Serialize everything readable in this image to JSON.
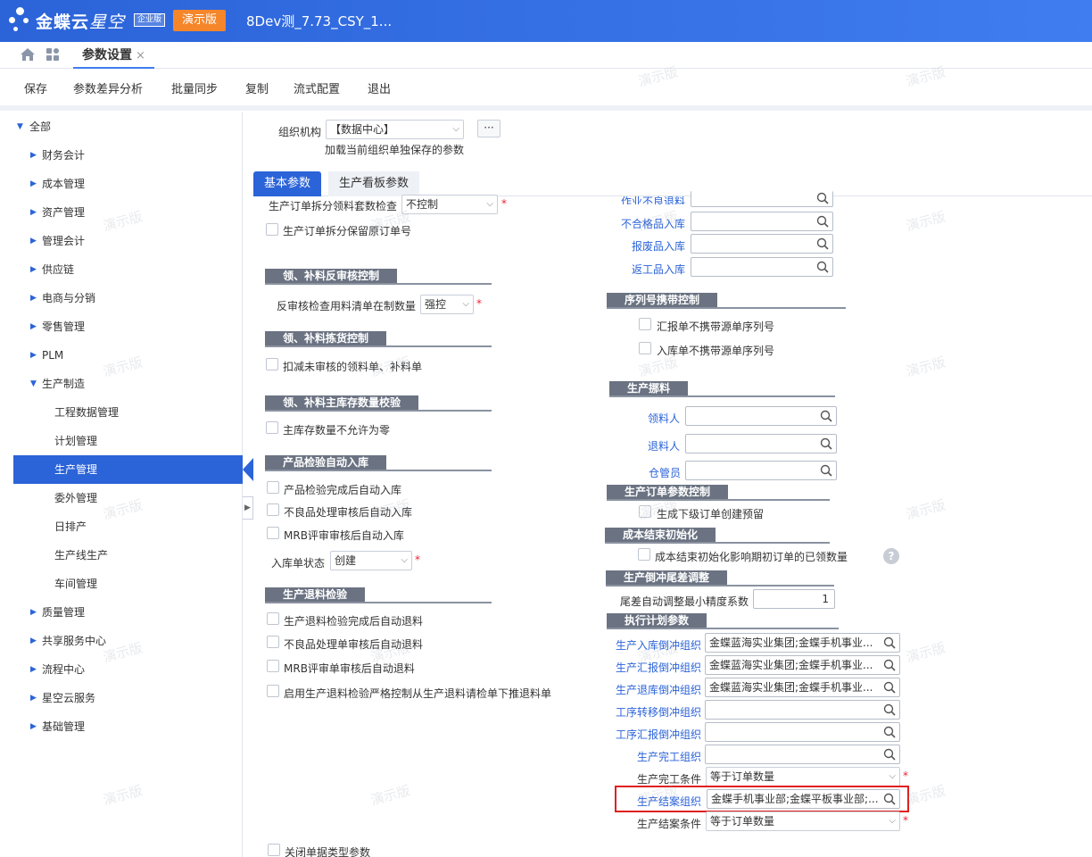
{
  "header": {
    "brand": "金蝶云",
    "brand_sub": "星空",
    "edition_badge": "企业版",
    "demo_button": "演示版",
    "db_title": "8Dev测_7.73_CSY_1..."
  },
  "tabs": {
    "active_tab": "参数设置",
    "close": "×"
  },
  "toolbar": [
    "保存",
    "参数差异分析",
    "批量同步",
    "复制",
    "流式配置",
    "退出"
  ],
  "watermark": "演示版",
  "sidebar": [
    {
      "label": "全部",
      "caret": "▼"
    },
    {
      "label": "财务会计",
      "caret": "▶"
    },
    {
      "label": "成本管理",
      "caret": "▶"
    },
    {
      "label": "资产管理",
      "caret": "▶"
    },
    {
      "label": "管理会计",
      "caret": "▶"
    },
    {
      "label": "供应链",
      "caret": "▶"
    },
    {
      "label": "电商与分销",
      "caret": "▶"
    },
    {
      "label": "零售管理",
      "caret": "▶"
    },
    {
      "label": "PLM",
      "caret": "▶"
    },
    {
      "label": "生产制造",
      "caret": "▼"
    },
    {
      "label": "工程数据管理",
      "caret": ""
    },
    {
      "label": "计划管理",
      "caret": ""
    },
    {
      "label": "生产管理",
      "caret": "",
      "active": true
    },
    {
      "label": "委外管理",
      "caret": ""
    },
    {
      "label": "日排产",
      "caret": ""
    },
    {
      "label": "生产线生产",
      "caret": ""
    },
    {
      "label": "车间管理",
      "caret": ""
    },
    {
      "label": "质量管理",
      "caret": "▶"
    },
    {
      "label": "共享服务中心",
      "caret": "▶"
    },
    {
      "label": "流程中心",
      "caret": "▶"
    },
    {
      "label": "星空云服务",
      "caret": "▶"
    },
    {
      "label": "基础管理",
      "caret": "▶"
    }
  ],
  "org": {
    "label": "组织机构",
    "value": "【数据中心】",
    "ellipsis": "···",
    "hint": "加载当前组织单独保存的参数"
  },
  "param_tabs": [
    "基本参数",
    "生产看板参数"
  ],
  "left": {
    "split_check_label": "生产订单拆分领料套数检查",
    "split_check_value": "不控制",
    "split_keep_no": "生产订单拆分保留原订单号",
    "sec_reaudit": "领、补料反审核控制",
    "reaudit_label": "反审核检查用料清单在制数量",
    "reaudit_value": "强控",
    "sec_pick": "领、补料拣货控制",
    "pick_deduct": "扣减未审核的领料单、补料单",
    "sec_stock": "领、补料主库存数量校验",
    "stock_no_zero": "主库存数量不允许为零",
    "sec_inspect": "产品检验自动入库",
    "inspect_1": "产品检验完成后自动入库",
    "inspect_2": "不良品处理审核后自动入库",
    "inspect_3": "MRB评审审核后自动入库",
    "instock_status_label": "入库单状态",
    "instock_status_value": "创建",
    "sec_return": "生产退料检验",
    "return_1": "生产退料检验完成后自动退料",
    "return_2": "不良品处理单审核后自动退料",
    "return_3": "MRB评审单审核后自动退料",
    "return_4": "启用生产退料检验严格控制从生产退料请检单下推退料单",
    "close_bill_type": "关闭单据类型参数"
  },
  "right": {
    "top_lookups": [
      "作业不良退料",
      "不合格品入库",
      "报废品入库",
      "返工品入库"
    ],
    "sec_serial": "序列号携带控制",
    "serial_1": "汇报单不携带源单序列号",
    "serial_2": "入库单不携带源单序列号",
    "sec_move": "生产挪料",
    "move_lookups": [
      "领料人",
      "退料人",
      "仓管员"
    ],
    "sec_order": "生产订单参数控制",
    "order_1": "生成下级订单创建预留",
    "sec_cost": "成本结束初始化",
    "cost_1": "成本结束初始化影响期初订单的已领数量",
    "help": "?",
    "sec_offset": "生产倒冲尾差调整",
    "offset_label": "尾差自动调整最小精度系数",
    "offset_value": "1",
    "sec_exec": "执行计划参数",
    "exec_rows": [
      {
        "label": "生产入库倒冲组织",
        "value": "金蝶蓝海实业集团;金蝶手机事业..."
      },
      {
        "label": "生产汇报倒冲组织",
        "value": "金蝶蓝海实业集团;金蝶手机事业..."
      },
      {
        "label": "生产退库倒冲组织",
        "value": "金蝶蓝海实业集团;金蝶手机事业..."
      },
      {
        "label": "工序转移倒冲组织",
        "value": ""
      },
      {
        "label": "工序汇报倒冲组织",
        "value": ""
      },
      {
        "label": "生产完工组织",
        "value": ""
      }
    ],
    "complete_cond_label": "生产完工条件",
    "complete_cond_value": "等于订单数量",
    "close_org_label": "生产结案组织",
    "close_org_value": "金蝶手机事业部;金蝶平板事业部;...",
    "close_cond_label": "生产结案条件",
    "close_cond_value": "等于订单数量"
  }
}
